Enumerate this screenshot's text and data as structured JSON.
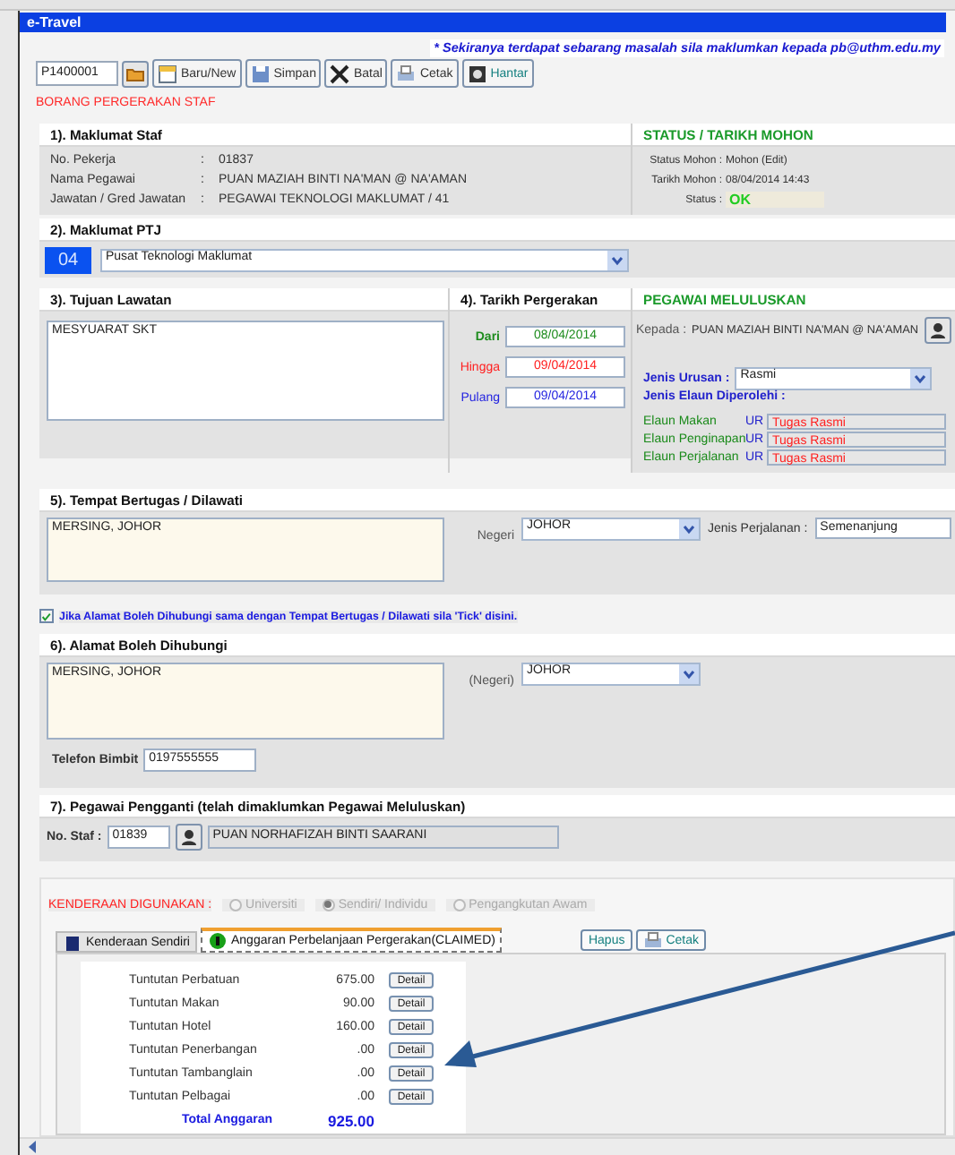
{
  "window": {
    "title": "e-Travel"
  },
  "notice": "* Sekiranya terdapat sebarang masalah sila maklumkan kepada pb@uthm.edu.my",
  "toolbar": {
    "record_no": "P1400001",
    "buttons": [
      {
        "label": "Baru/New"
      },
      {
        "label": "Simpan"
      },
      {
        "label": "Batal"
      },
      {
        "label": "Cetak"
      },
      {
        "label": "Hantar"
      }
    ]
  },
  "form_title": "BORANG PERGERAKAN STAF",
  "staff": {
    "heading": "1). Maklumat Staf",
    "fields": [
      {
        "label": "No. Pekerja",
        "separator": ":",
        "value": "01837"
      },
      {
        "label": "Nama Pegawai",
        "separator": ":",
        "value": "PUAN MAZIAH BINTI NA'MAN @ NA'AMAN"
      },
      {
        "label": "Jawatan / Gred Jawatan",
        "separator": ":",
        "value": "PEGAWAI TEKNOLOGI MAKLUMAT /  41"
      }
    ]
  },
  "status": {
    "heading": "STATUS / TARIKH MOHON",
    "rows": [
      {
        "label": "Status Mohon :",
        "value": "Mohon (Edit)",
        "kind": "text"
      },
      {
        "label": "Tarikh Mohon :",
        "value": "08/04/2014 14:43",
        "kind": "text"
      },
      {
        "label": "Status :",
        "value": "OK",
        "kind": "badge"
      }
    ]
  },
  "ptj": {
    "heading": "2). Maklumat PTJ",
    "code": "04",
    "value": "Pusat Teknologi Maklumat"
  },
  "purpose": {
    "heading": "3). Tujuan Lawatan",
    "value": "MESYUARAT SKT"
  },
  "dates": {
    "heading": "4). Tarikh Pergerakan",
    "rows": [
      {
        "label": "Dari",
        "value": "08/04/2014",
        "color": "#1e8c1e"
      },
      {
        "label": "Hingga",
        "value": "09/04/2014",
        "color": "#ff2020"
      },
      {
        "label": "Pulang",
        "value": "09/04/2014",
        "color": "#2424e0"
      }
    ]
  },
  "approver": {
    "heading": "PEGAWAI MELULUSKAN",
    "to_label": "Kepada :",
    "to_value": "PUAN MAZIAH BINTI NA'MAN @ NA'AMAN",
    "type_label": "Jenis Urusan :",
    "type_value": "Rasmi",
    "allowance_heading": "Jenis Elaun Diperolehi :",
    "allowances": [
      {
        "label": "Elaun Makan",
        "code": "UR",
        "value": "Tugas Rasmi"
      },
      {
        "label": "Elaun Penginapan",
        "code": "UR",
        "value": "Tugas Rasmi"
      },
      {
        "label": "Elaun Perjalanan",
        "code": "UR",
        "value": "Tugas Rasmi"
      }
    ]
  },
  "place": {
    "heading": "5). Tempat Bertugas / Dilawati",
    "address": "MERSING, JOHOR",
    "state_label": "Negeri",
    "state": "JOHOR",
    "trip_label": "Jenis Perjalanan :",
    "trip": "Semenanjung"
  },
  "same_address": {
    "checked": true,
    "label": "Jika Alamat Boleh Dihubungi sama dengan Tempat Bertugas / Dilawati sila 'Tick' disini."
  },
  "contact": {
    "heading": "6). Alamat Boleh Dihubungi",
    "address": "MERSING, JOHOR",
    "state_label": "(Negeri)",
    "state": "JOHOR",
    "phone_label": "Telefon Bimbit",
    "phone": "0197555555"
  },
  "replacement": {
    "heading": "7). Pegawai Pengganti (telah dimaklumkan Pegawai Meluluskan)",
    "staff_label": "No. Staf :",
    "staff_no": "01839",
    "name": "PUAN NORHAFIZAH BINTI SAARANI"
  },
  "vehicle": {
    "label": "KENDERAAN DIGUNAKAN :",
    "options": [
      {
        "label": "Universiti",
        "selected": false,
        "disabled": true
      },
      {
        "label": "Sendiri/ Individu",
        "selected": true,
        "disabled": true
      },
      {
        "label": "Pengangkutan Awam",
        "selected": false,
        "disabled": true
      }
    ]
  },
  "tabs": [
    {
      "label": "Kenderaan Sendiri",
      "selected": false
    },
    {
      "label": "Anggaran Perbelanjaan Pergerakan(CLAIMED)",
      "selected": true
    }
  ],
  "tab_actions": [
    {
      "label": "Hapus"
    },
    {
      "label": "Cetak"
    }
  ],
  "claims": {
    "rows": [
      {
        "label": "Tuntutan Perbatuan",
        "amount": "675.00",
        "button": "Detail"
      },
      {
        "label": "Tuntutan Makan",
        "amount": "90.00",
        "button": "Detail"
      },
      {
        "label": "Tuntutan Hotel",
        "amount": "160.00",
        "button": "Detail"
      },
      {
        "label": "Tuntutan Penerbangan",
        "amount": ".00",
        "button": "Detail"
      },
      {
        "label": "Tuntutan Tambanglain",
        "amount": ".00",
        "button": "Detail"
      },
      {
        "label": "Tuntutan Pelbagai",
        "amount": ".00",
        "button": "Detail"
      }
    ],
    "total_label": "Total Anggaran",
    "total": "925.00"
  }
}
